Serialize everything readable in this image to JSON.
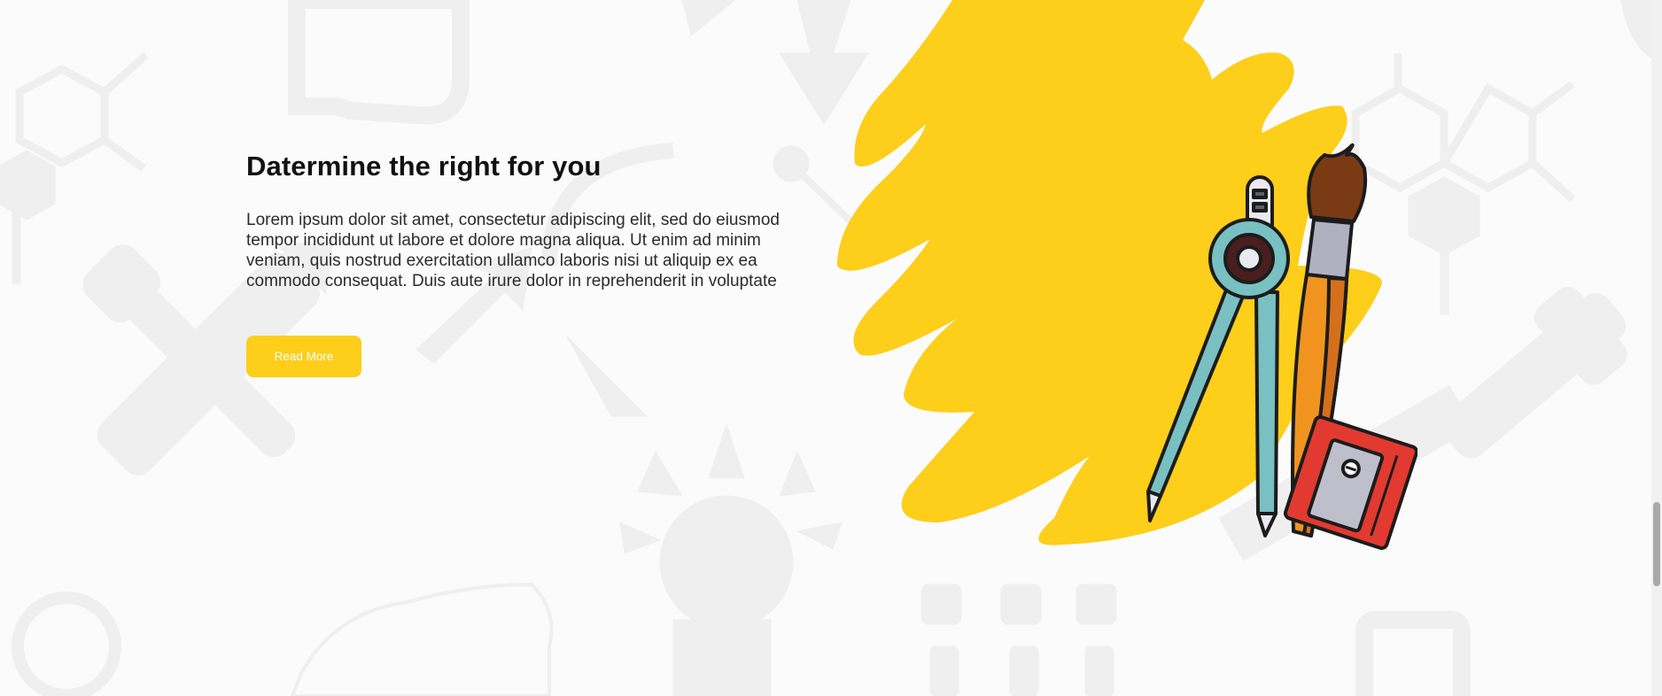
{
  "section": {
    "title": "Datermine the right for you",
    "body": "Lorem ipsum dolor sit amet, consectetur adipiscing elit, sed do eiusmod tempor incididunt ut labore et dolore magna aliqua. Ut enim ad minim veniam, quis nostrud exercitation ullamco laboris nisi ut aliquip ex ea commodo consequat. Duis aute irure dolor in reprehenderit in voluptate",
    "button_label": "Read More"
  },
  "illustration": {
    "name": "compass-brush-sharpener-illustration",
    "blob_color": "#fdce1a"
  },
  "colors": {
    "accent": "#fdce1a",
    "background": "#fbfbfb",
    "pattern": "#efefef"
  },
  "scrollbar": {
    "position_fraction": 0.82
  }
}
